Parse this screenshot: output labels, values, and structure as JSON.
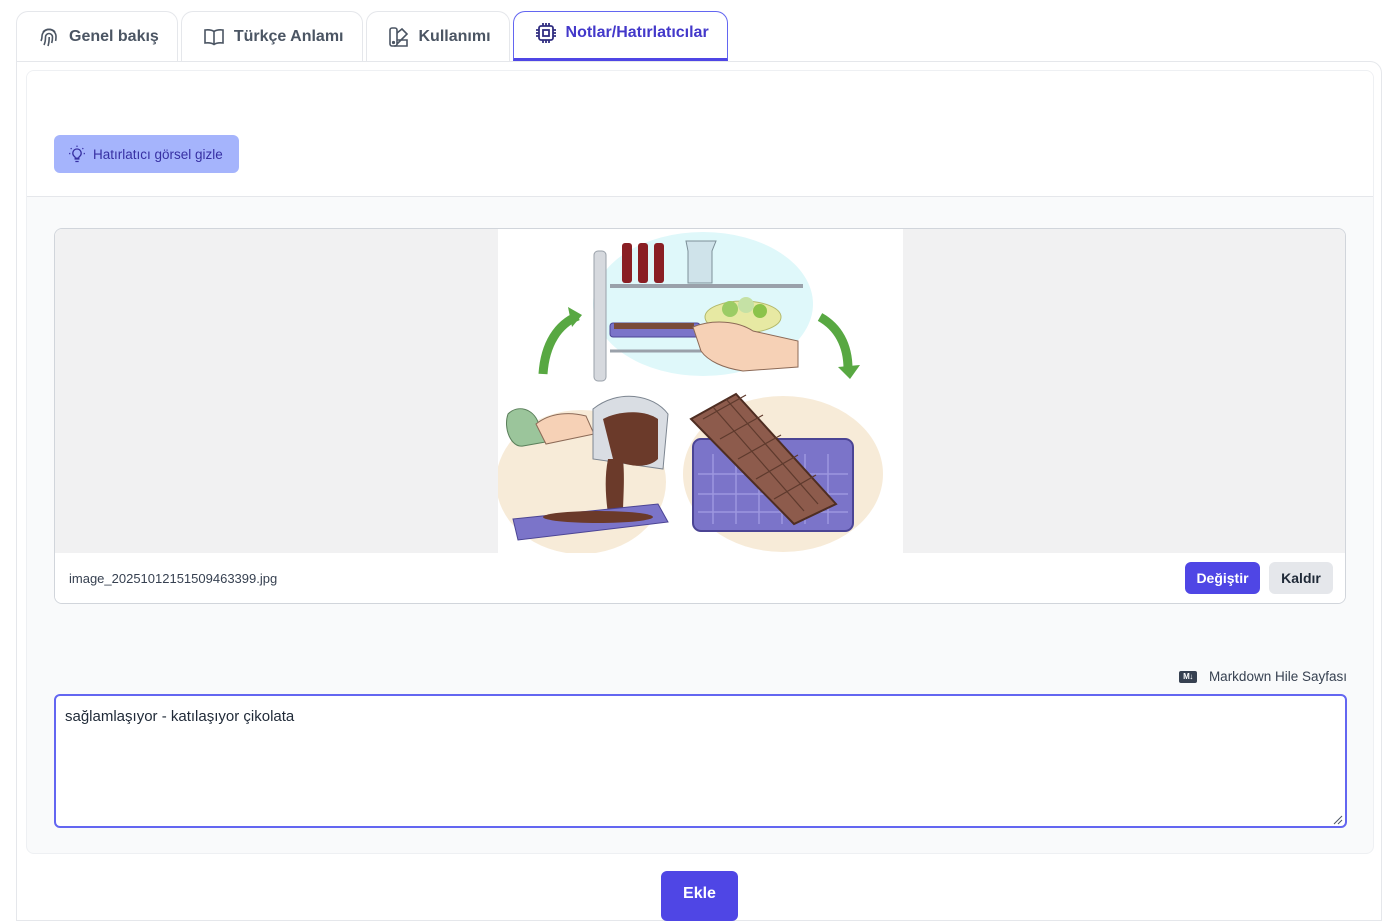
{
  "tabs": [
    {
      "label": "Genel bakış",
      "icon": "fingerprint-icon"
    },
    {
      "label": "Türkçe Anlamı",
      "icon": "book-icon"
    },
    {
      "label": "Kullanımı",
      "icon": "swatch-icon"
    },
    {
      "label": "Notlar/Hatırlatıcılar",
      "icon": "cpu-chip-icon",
      "active": true
    }
  ],
  "hint_button": {
    "label": "Hatırlatıcı görsel gizle",
    "icon": "lightbulb-icon"
  },
  "image": {
    "filename": "image_20251012151509463399.jpg",
    "change_label": "Değiştir",
    "remove_label": "Kaldır"
  },
  "markdown": {
    "label": "Markdown Hile Sayfası",
    "icon": "markdown-icon"
  },
  "note": {
    "value": "sağlamlaşıyor - katılaşıyor çikolata"
  },
  "add_label": "Ekle",
  "colors": {
    "accent": "#4f46e5",
    "hint_bg": "#a5b4fc",
    "secondary_btn": "#e5e7eb"
  }
}
